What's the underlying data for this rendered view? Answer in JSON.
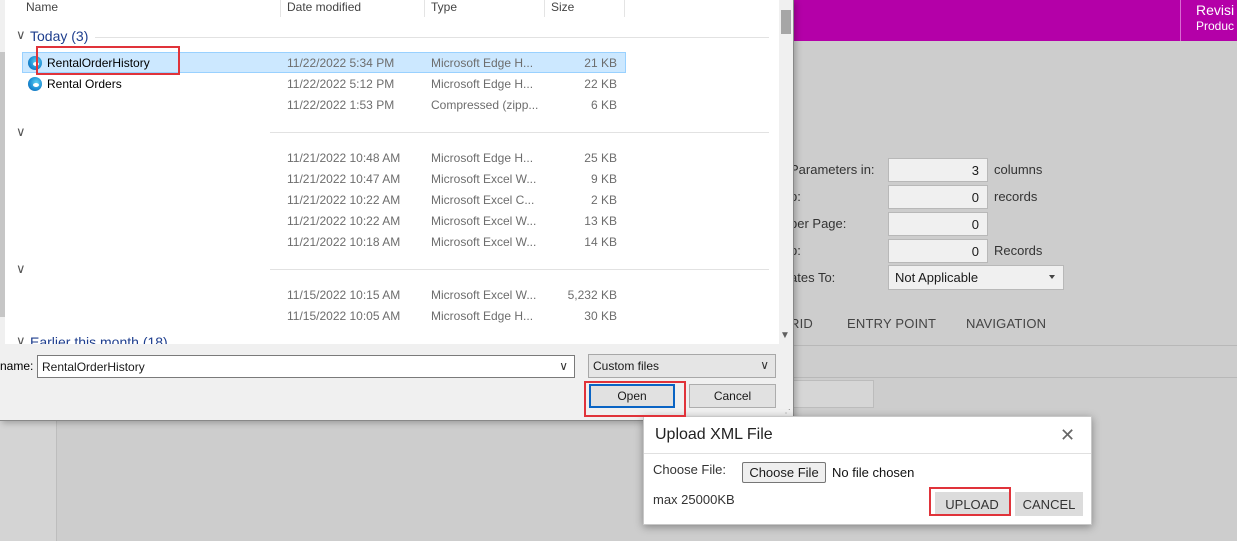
{
  "app": {
    "header_title": "Revisi",
    "header_subtitle": "Produc",
    "form": {
      "params_label": "Parameters in:",
      "params_value": "3",
      "params_suffix": "columns",
      "row2_label": "p:",
      "row2_value": "0",
      "row2_suffix": "records",
      "row3_label": "ber Page:",
      "row3_value": "0",
      "row4_label": "p:",
      "row4_value": "0",
      "row4_suffix": "Records",
      "relates_label": "ates To:",
      "relates_value": "Not Applicable"
    },
    "tabs": [
      "RID",
      "ENTRY POINT",
      "NAVIGATION"
    ]
  },
  "file_dialog": {
    "columns": {
      "name": "Name",
      "date": "Date modified",
      "type": "Type",
      "size": "Size"
    },
    "groups": {
      "today": "Today (3)",
      "earlier": "Earlier this month (18)"
    },
    "today_files": [
      {
        "name": "RentalOrderHistory",
        "date": "11/22/2022 5:34 PM",
        "type": "Microsoft Edge H...",
        "size": "21 KB"
      },
      {
        "name": "Rental Orders",
        "date": "11/22/2022 5:12 PM",
        "type": "Microsoft Edge H...",
        "size": "22 KB"
      },
      {
        "name": "",
        "date": "11/22/2022 1:53 PM",
        "type": "Compressed (zipp...",
        "size": "6 KB"
      }
    ],
    "group2_files": [
      {
        "date": "11/21/2022 10:48 AM",
        "type": "Microsoft Edge H...",
        "size": "25 KB"
      },
      {
        "date": "11/21/2022 10:47 AM",
        "type": "Microsoft Excel W...",
        "size": "9 KB"
      },
      {
        "date": "11/21/2022 10:22 AM",
        "type": "Microsoft Excel C...",
        "size": "2 KB"
      },
      {
        "date": "11/21/2022 10:22 AM",
        "type": "Microsoft Excel W...",
        "size": "13 KB"
      },
      {
        "date": "11/21/2022 10:18 AM",
        "type": "Microsoft Excel W...",
        "size": "14 KB"
      }
    ],
    "group3_files": [
      {
        "date": "11/15/2022 10:15 AM",
        "type": "Microsoft Excel W...",
        "size": "5,232 KB"
      },
      {
        "date": "11/15/2022 10:05 AM",
        "type": "Microsoft Edge H...",
        "size": "30 KB"
      }
    ],
    "filename_label": "name:",
    "filename_value": "RentalOrderHistory",
    "filetype_value": "Custom files",
    "open_label": "Open",
    "cancel_label": "Cancel"
  },
  "upload_modal": {
    "title": "Upload XML File",
    "close_glyph": "✕",
    "choose_label": "Choose File:",
    "choose_button": "Choose File",
    "no_file": "No file chosen",
    "max_size": "max 25000KB",
    "upload_label": "UPLOAD",
    "cancel_label": "CANCEL"
  },
  "colors": {
    "header": "#b400a8",
    "highlight": "#e0333a",
    "selection": "#cce8ff",
    "group_text": "#1e3e8e"
  }
}
